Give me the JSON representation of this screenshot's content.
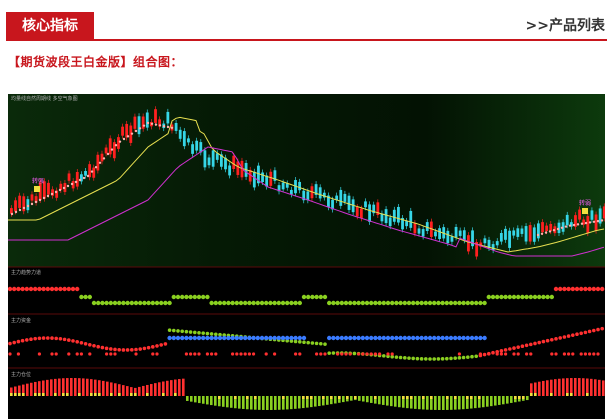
{
  "header": {
    "tab_title": "核心指标",
    "product_list_link": ">>产品列表"
  },
  "caption": "【期货波段王白金版】组合图：",
  "chart": {
    "panel_labels": [
      "均量线自然周期线  多空气象图",
      "主力趋势力道",
      "主力资金",
      "主力仓位"
    ],
    "signals": [
      "转强",
      "转弱"
    ],
    "colors": {
      "accent": "#c8161d",
      "bull_candle": "#ff2020",
      "bear_candle": "#36d6e7",
      "ma_yellow": "#e8e050",
      "ma_magenta": "#d030d0",
      "green_dot": "#8ad020",
      "red_dot": "#ff3030",
      "blue_dot": "#3a7bff"
    }
  }
}
